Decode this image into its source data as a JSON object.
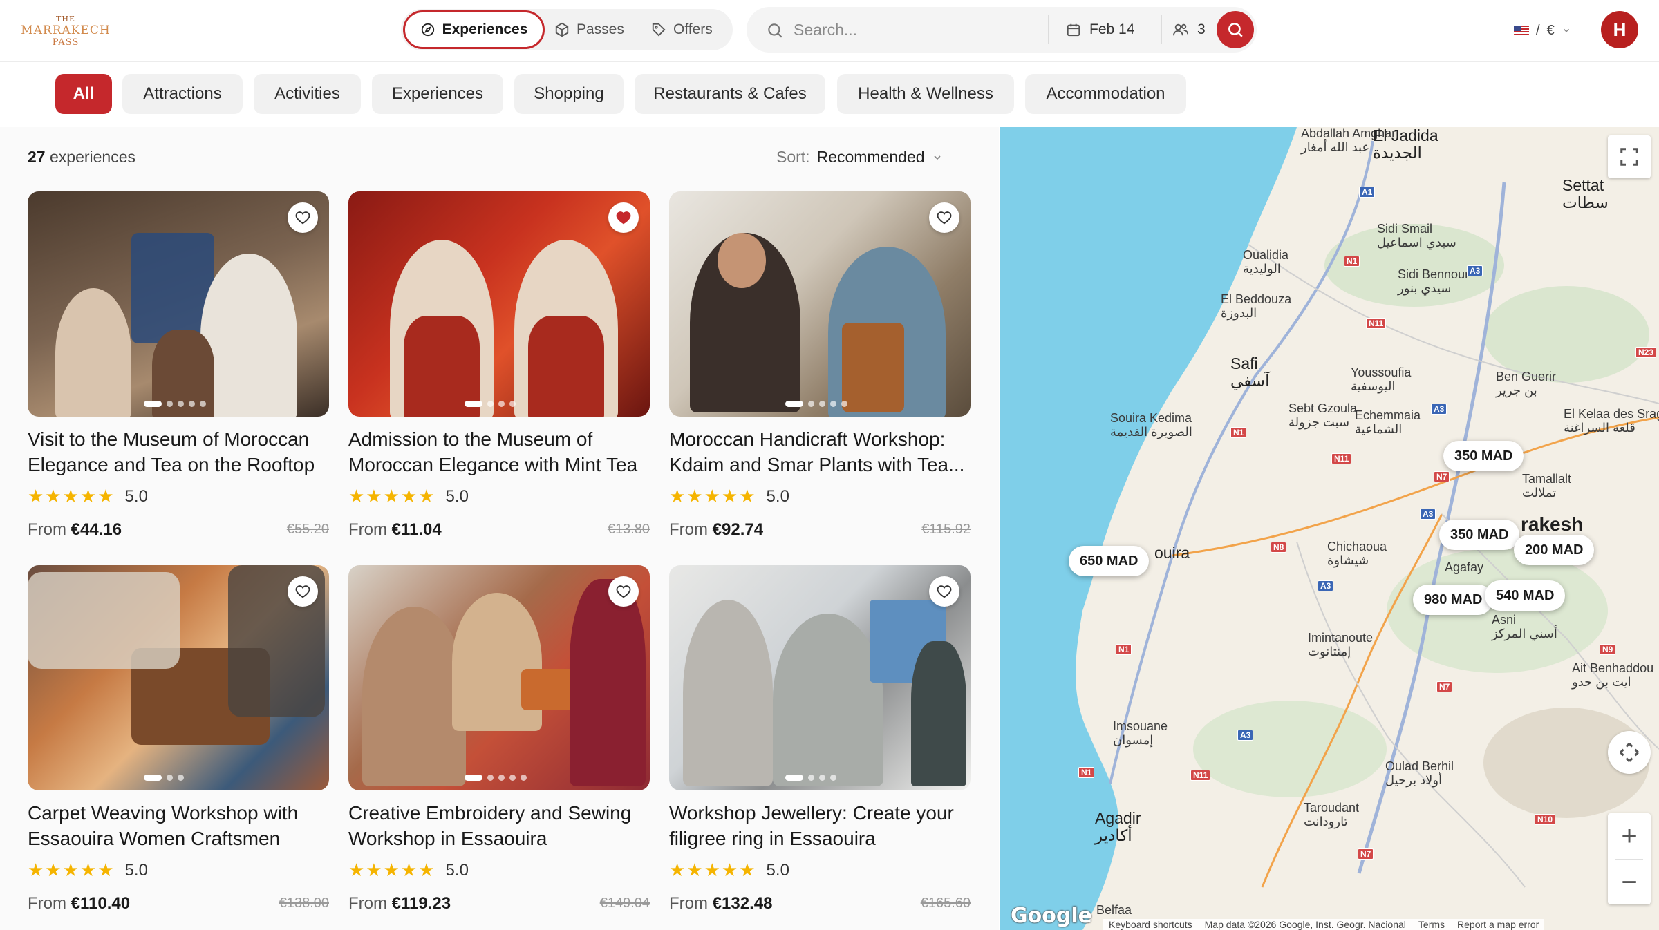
{
  "logo": {
    "line1": "THE",
    "line2": "MARRAKECH",
    "line3": "PASS"
  },
  "nav": {
    "experiences": "Experiences",
    "passes": "Passes",
    "offers": "Offers"
  },
  "search": {
    "placeholder": "Search...",
    "date": "Feb 14",
    "guests": "3"
  },
  "locale": {
    "separator": "/",
    "currency": "€"
  },
  "user": {
    "initial": "H"
  },
  "categories": [
    "All",
    "Attractions",
    "Activities",
    "Experiences",
    "Shopping",
    "Restaurants & Cafes",
    "Health & Wellness",
    "Accommodation"
  ],
  "listing": {
    "count": "27",
    "count_label": "experiences",
    "sort_label": "Sort:",
    "sort_value": "Recommended"
  },
  "cards": [
    {
      "title": "Visit to the Museum of Moroccan Elegance and Tea on the Rooftop",
      "rating": "5.0",
      "from": "From",
      "price": "€44.16",
      "old_price": "€55.20",
      "favorited": false
    },
    {
      "title": "Admission to the Museum of Moroccan Elegance with Mint Tea",
      "rating": "5.0",
      "from": "From",
      "price": "€11.04",
      "old_price": "€13.80",
      "favorited": true
    },
    {
      "title": "Moroccan Handicraft Workshop: Kdaim and Smar Plants with Tea...",
      "rating": "5.0",
      "from": "From",
      "price": "€92.74",
      "old_price": "€115.92",
      "favorited": false
    },
    {
      "title": "Carpet Weaving Workshop with Essaouira Women Craftsmen",
      "rating": "5.0",
      "from": "From",
      "price": "€110.40",
      "old_price": "€138.00",
      "favorited": false
    },
    {
      "title": "Creative Embroidery and Sewing Workshop in Essaouira",
      "rating": "5.0",
      "from": "From",
      "price": "€119.23",
      "old_price": "€149.04",
      "favorited": false
    },
    {
      "title": "Workshop Jewellery: Create your filigree ring in Essaouira",
      "rating": "5.0",
      "from": "From",
      "price": "€132.48",
      "old_price": "€165.60",
      "favorited": false
    }
  ],
  "map": {
    "places": [
      {
        "name": "Abdallah Amghar",
        "ar": "عبد الله أمغار"
      },
      {
        "name": "El Jadida",
        "ar": "الجديدة"
      },
      {
        "name": "Settat",
        "ar": "سطات"
      },
      {
        "name": "Sidi Smail",
        "ar": "سيدي اسماعيل"
      },
      {
        "name": "Oualidia",
        "ar": "الوليدية"
      },
      {
        "name": "Sidi Bennour",
        "ar": "سيدي بنور"
      },
      {
        "name": "El Beddouza",
        "ar": "البدوزة"
      },
      {
        "name": "Safi",
        "ar": "آسفي"
      },
      {
        "name": "Youssoufia",
        "ar": "اليوسفية"
      },
      {
        "name": "Ben Guerir",
        "ar": "بن جرير"
      },
      {
        "name": "Sebt Gzoula",
        "ar": "سبت جزولة"
      },
      {
        "name": "Echemmaia",
        "ar": "الشماعية"
      },
      {
        "name": "Souira Kedima",
        "ar": "الصويرة القديمة"
      },
      {
        "name": "El Kelaa des Sraghna",
        "ar": "قلعة السراغنة"
      },
      {
        "name": "Tamallalt",
        "ar": "تملالت"
      },
      {
        "name": "Marrakesh",
        "ar": "rakesh"
      },
      {
        "name": "Essaouira",
        "ar": "ouira"
      },
      {
        "name": "Chichaoua",
        "ar": "شيشاوة"
      },
      {
        "name": "Agafay",
        "ar": ""
      },
      {
        "name": "Asni",
        "ar": "أسني المركز"
      },
      {
        "name": "Imintanoute",
        "ar": "إمنتانوت"
      },
      {
        "name": "Ait Benhaddou",
        "ar": "ايت بن حدو"
      },
      {
        "name": "Imsouane",
        "ar": "إمسوان"
      },
      {
        "name": "Oulad Berhil",
        "ar": "أولاد برحيل"
      },
      {
        "name": "Agadir",
        "ar": "أكادير"
      },
      {
        "name": "Taroudant",
        "ar": "تارودانت"
      },
      {
        "name": "Belfaa",
        "ar": ""
      }
    ],
    "roads": [
      "A1",
      "N1",
      "A3",
      "N11",
      "N23",
      "A3",
      "N1",
      "N11",
      "N7",
      "A3",
      "N8",
      "A3",
      "N1",
      "N7",
      "N9",
      "A3",
      "N11",
      "N1",
      "N10",
      "N7"
    ],
    "prices": [
      "350 MAD",
      "350 MAD",
      "200 MAD",
      "650 MAD",
      "980 MAD",
      "540 MAD"
    ],
    "brand": "Google",
    "attribution": [
      "Keyboard shortcuts",
      "Map data ©2026 Google, Inst. Geogr. Nacional",
      "Terms",
      "Report a map error"
    ],
    "zoom_in": "+",
    "zoom_out": "−"
  }
}
